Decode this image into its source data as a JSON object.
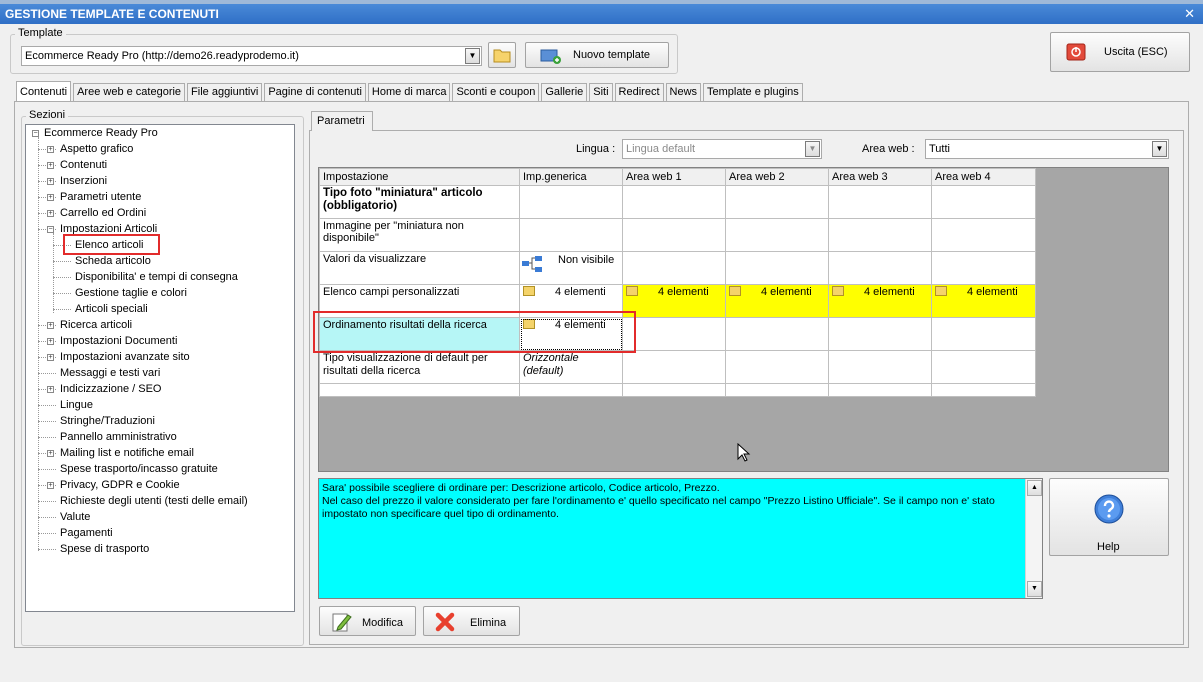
{
  "window": {
    "title": "GESTIONE TEMPLATE E CONTENUTI",
    "close": "✕"
  },
  "template": {
    "group_label": "Template",
    "selected": "Ecommerce Ready Pro (http://demo26.readyprodemo.it)",
    "new_button": "Nuovo template",
    "exit_button": "Uscita (ESC)"
  },
  "tabs": [
    "Contenuti",
    "Aree web e categorie",
    "File aggiuntivi",
    "Pagine di contenuti",
    "Home di marca",
    "Sconti e coupon",
    "Gallerie",
    "Siti",
    "Redirect",
    "News",
    "Template e plugins"
  ],
  "sections": {
    "label": "Sezioni",
    "root": "Ecommerce Ready Pro",
    "items": [
      "Aspetto grafico",
      "Contenuti",
      "Inserzioni",
      "Parametri utente",
      "Carrello ed Ordini",
      "Impostazioni Articoli",
      "Elenco articoli",
      "Scheda articolo",
      "Disponibilita' e tempi di consegna",
      "Gestione taglie e colori",
      "Articoli speciali",
      "Ricerca articoli",
      "Impostazioni Documenti",
      "Impostazioni avanzate sito",
      "Messaggi e testi vari",
      "Indicizzazione / SEO",
      "Lingue",
      "Stringhe/Traduzioni",
      "Pannello amministrativo",
      "Mailing list e notifiche email",
      "Spese trasporto/incasso gratuite",
      "Privacy, GDPR e Cookie",
      "Richieste degli utenti (testi delle email)",
      "Valute",
      "Pagamenti",
      "Spese di trasporto"
    ]
  },
  "parametri": {
    "tab": "Parametri",
    "lingua_label": "Lingua :",
    "lingua_value": "Lingua default",
    "area_label": "Area web :",
    "area_value": "Tutti"
  },
  "grid": {
    "headers": [
      "Impostazione",
      "Imp.generica",
      "Area web 1",
      "Area web 2",
      "Area web 3",
      "Area web 4"
    ],
    "rows": [
      {
        "name": "Tipo foto \"miniatura\" articolo (obbligatorio)",
        "generic": "",
        "a1": "",
        "a2": "",
        "a3": "",
        "a4": ""
      },
      {
        "name": "Immagine per \"miniatura non disponibile\"",
        "generic": "",
        "a1": "",
        "a2": "",
        "a3": "",
        "a4": ""
      },
      {
        "name": "Valori da visualizzare",
        "generic": "Non visibile",
        "a1": "",
        "a2": "",
        "a3": "",
        "a4": ""
      },
      {
        "name": "Elenco campi personalizzati",
        "generic": "4 elementi",
        "a1": "4 elementi",
        "a2": "4 elementi",
        "a3": "4 elementi",
        "a4": "4 elementi"
      },
      {
        "name": "Ordinamento risultati della ricerca",
        "generic": "4 elementi",
        "a1": "",
        "a2": "",
        "a3": "",
        "a4": ""
      },
      {
        "name": "Tipo visualizzazione di default per risultati della ricerca",
        "generic": "Orizzontale (default)",
        "a1": "",
        "a2": "",
        "a3": "",
        "a4": ""
      }
    ]
  },
  "help": {
    "text1": "Sara' possibile scegliere di ordinare per: Descrizione articolo, Codice articolo, Prezzo.",
    "text2": "Nel caso del prezzo il valore considerato per fare l'ordinamento e' quello specificato nel campo \"Prezzo Listino Ufficiale\". Se il campo non e' stato impostato non specificare quel tipo di ordinamento.",
    "button": "Help"
  },
  "actions": {
    "edit": "Modifica",
    "delete": "Elimina"
  },
  "colors": {
    "titlebar": "#2f6fc6",
    "highlight": "#ffff00",
    "help_bg": "#00ffff",
    "selected_row": "#b6f6f6",
    "annotation": "#e22b2b"
  }
}
